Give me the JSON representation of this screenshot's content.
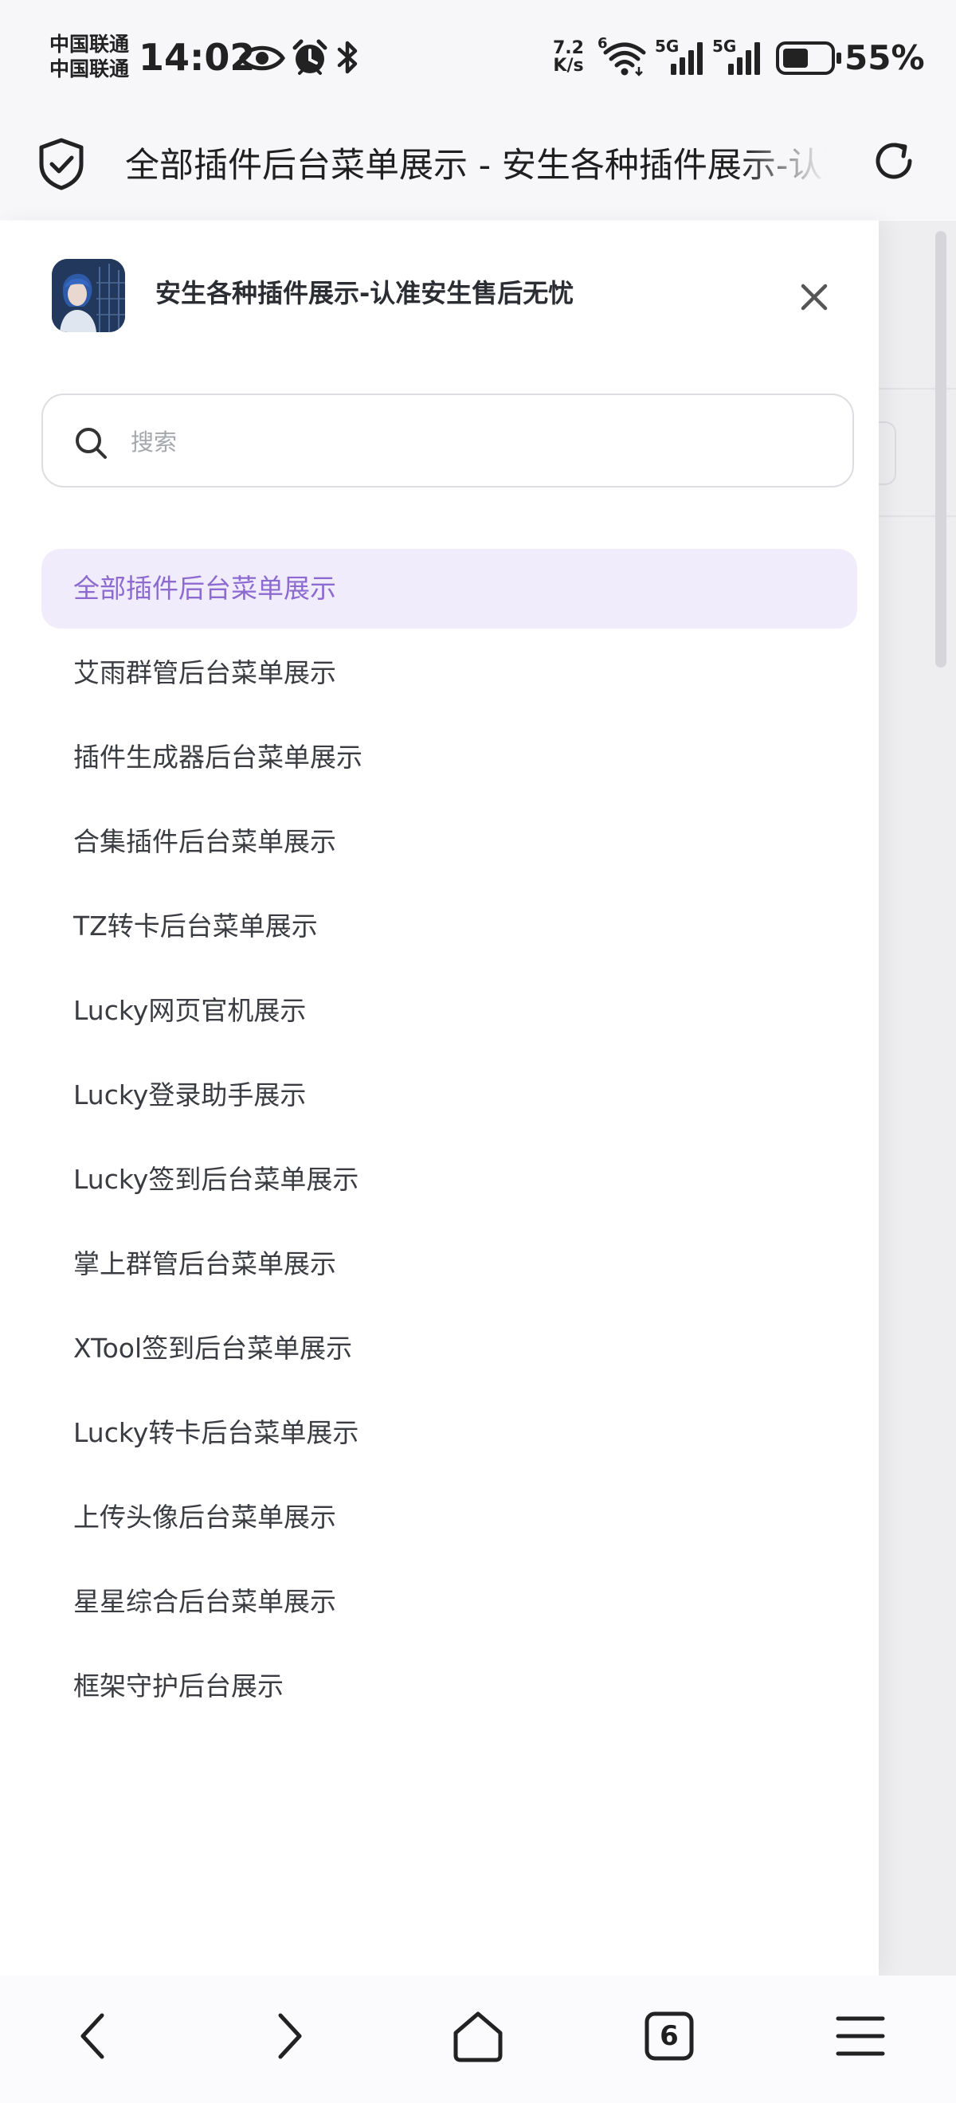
{
  "status_bar": {
    "carrier_1": "中国联通",
    "carrier_2": "中国联通",
    "time": "14:02",
    "net_speed_value": "7.2",
    "net_speed_unit": "K/s",
    "signal_1_label": "5G",
    "signal_2_label": "5G",
    "wifi_label": "6",
    "battery_percent": "55%",
    "battery_level": 0.55,
    "icons": [
      "eye-icon",
      "alarm-icon",
      "bluetooth-icon",
      "wifi-icon",
      "signal-icon",
      "battery-icon"
    ]
  },
  "address_bar": {
    "title": "全部插件后台菜单展示 - 安生各种插件展示-认准安生售后无忧",
    "icons": [
      "shield-check-icon",
      "refresh-icon"
    ]
  },
  "drawer": {
    "site_name": "安生各种插件展示-认准安生售后无忧",
    "search": {
      "placeholder": "搜索",
      "value": ""
    },
    "menu_items": [
      {
        "label": "全部插件后台菜单展示",
        "active": true
      },
      {
        "label": "艾雨群管后台菜单展示",
        "active": false
      },
      {
        "label": "插件生成器后台菜单展示",
        "active": false
      },
      {
        "label": "合集插件后台菜单展示",
        "active": false
      },
      {
        "label": "TZ转卡后台菜单展示",
        "active": false
      },
      {
        "label": "Lucky网页官机展示",
        "active": false
      },
      {
        "label": "Lucky登录助手展示",
        "active": false
      },
      {
        "label": "Lucky签到后台菜单展示",
        "active": false
      },
      {
        "label": "掌上群管后台菜单展示",
        "active": false
      },
      {
        "label": "XTool签到后台菜单展示",
        "active": false
      },
      {
        "label": "Lucky转卡后台菜单展示",
        "active": false
      },
      {
        "label": "上传头像后台菜单展示",
        "active": false
      },
      {
        "label": "星星综合后台菜单展示",
        "active": false
      },
      {
        "label": "框架守护后台展示",
        "active": false
      }
    ],
    "active_color": "#8c6ad0",
    "active_background": "#f0ecfb"
  },
  "bottom_nav": {
    "tab_count": "6",
    "icons": [
      "back-icon",
      "forward-icon",
      "home-icon",
      "tabs-icon",
      "menu-icon"
    ]
  }
}
